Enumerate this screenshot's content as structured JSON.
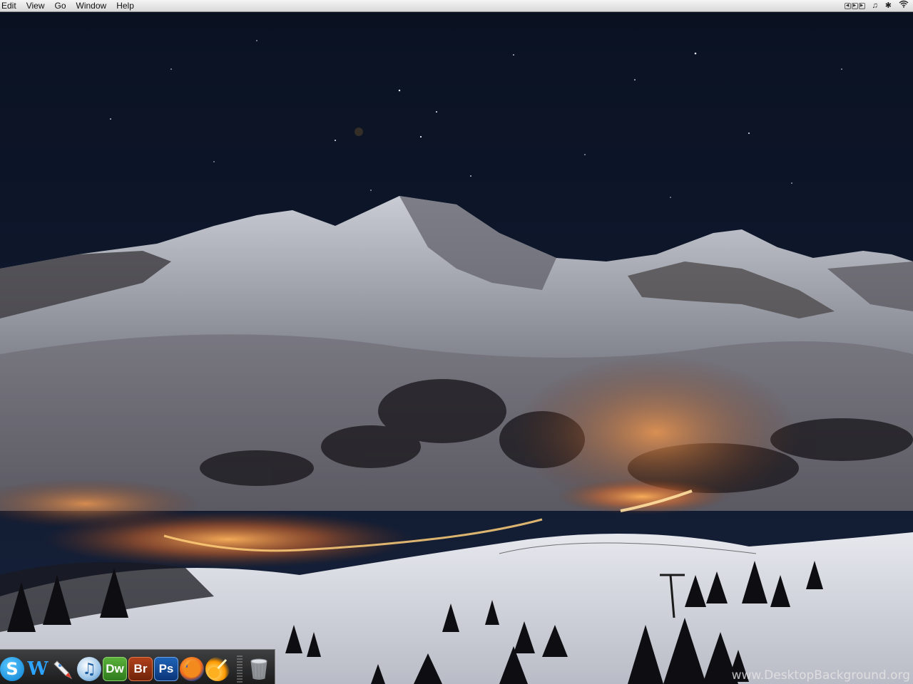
{
  "menubar": {
    "items": [
      {
        "label": "Edit"
      },
      {
        "label": "View"
      },
      {
        "label": "Go"
      },
      {
        "label": "Window"
      },
      {
        "label": "Help"
      }
    ],
    "status_icons": [
      "media-controls-icon",
      "music-note-icon",
      "bluetooth-icon",
      "wifi-icon"
    ]
  },
  "wallpaper": {
    "subject": "night-mountain-ski-resort"
  },
  "dock": {
    "apps": [
      {
        "name": "skype",
        "label": "S"
      },
      {
        "name": "wiki",
        "label": "W"
      },
      {
        "name": "rocket",
        "label": ""
      },
      {
        "name": "itunes",
        "label": "♫"
      },
      {
        "name": "dreamweaver",
        "label": "Dw"
      },
      {
        "name": "bridge",
        "label": "Br"
      },
      {
        "name": "photoshop",
        "label": "Ps"
      },
      {
        "name": "firefox",
        "label": ""
      },
      {
        "name": "comet",
        "label": ""
      }
    ],
    "trash": {
      "name": "trash"
    }
  },
  "watermark": {
    "text": "www.DesktopBackground.org"
  },
  "colors": {
    "sky": "#0d1526",
    "snow": "#d8dbe3",
    "glow": "#ff9a3c"
  }
}
